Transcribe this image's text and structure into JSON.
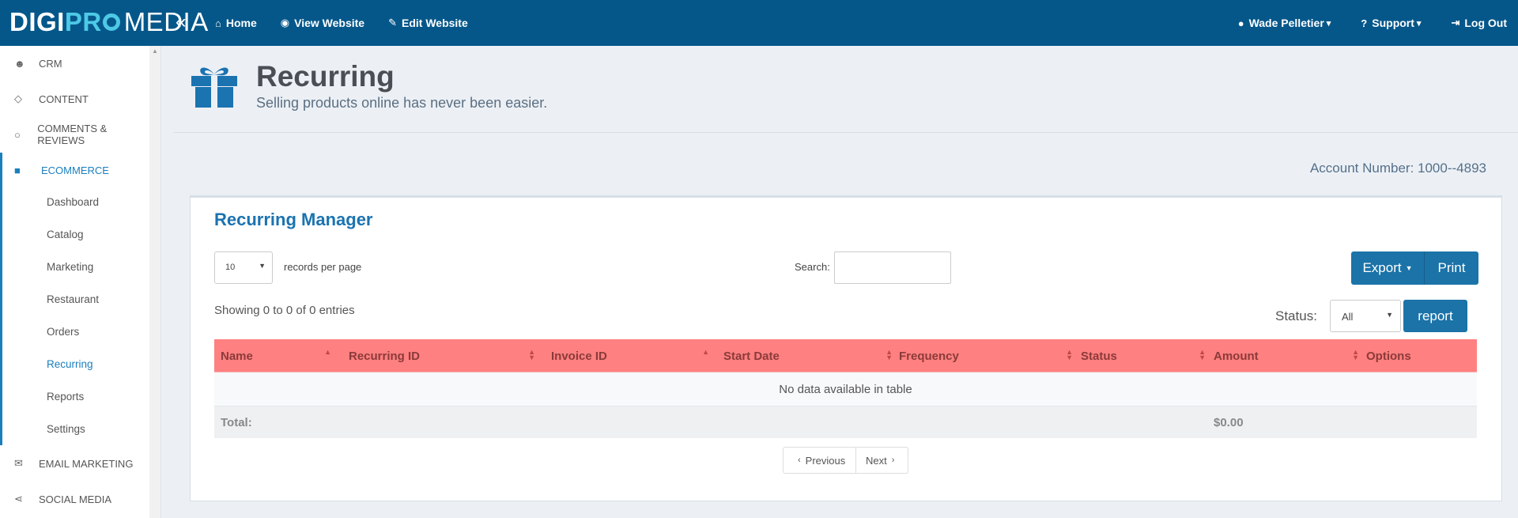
{
  "brand": {
    "part1": "DIGI",
    "part2a": "PR",
    "part2b": "",
    "part3": "MEDIA"
  },
  "topnav": {
    "collapse_glyph": "«",
    "links": [
      {
        "label": "Home",
        "icon": "home-icon"
      },
      {
        "label": "View Website",
        "icon": "eye-icon"
      },
      {
        "label": "Edit Website",
        "icon": "edit-icon"
      }
    ],
    "user": "Wade Pelletier",
    "support": "Support",
    "logout": "Log Out"
  },
  "sidebar": {
    "items": [
      {
        "label": "CRM",
        "icon": "users-icon"
      },
      {
        "label": "CONTENT",
        "icon": "diamond-icon"
      },
      {
        "label": "COMMENTS & REVIEWS",
        "icon": "comment-icon"
      },
      {
        "label": "ECOMMERCE",
        "icon": "gift-icon"
      },
      {
        "label": "EMAIL MARKETING",
        "icon": "envelope-icon"
      },
      {
        "label": "SOCIAL MEDIA",
        "icon": "share-icon"
      }
    ],
    "subitems": [
      "Dashboard",
      "Catalog",
      "Marketing",
      "Restaurant",
      "Orders",
      "Recurring",
      "Reports",
      "Settings"
    ]
  },
  "page": {
    "title": "Recurring",
    "subtitle": "Selling products online has never been easier.",
    "account_number": "Account Number: 1000--4893"
  },
  "panel": {
    "title": "Recurring Manager",
    "page_length": "10",
    "records_label": "records per page",
    "search_label": "Search:",
    "search_value": "",
    "export_label": "Export",
    "print_label": "Print",
    "showing": "Showing 0 to 0 of 0 entries",
    "status_label": "Status:",
    "status_value": "All",
    "report_label": "report",
    "columns": [
      "Name",
      "Recurring ID",
      "Invoice ID",
      "Start Date",
      "Frequency",
      "Status",
      "Amount",
      "Options"
    ],
    "empty_message": "No data available in table",
    "total_label": "Total:",
    "total_amount": "$0.00",
    "prev_label": "Previous",
    "next_label": "Next"
  },
  "colors": {
    "topbar": "#05578a",
    "accent": "#1b73b0",
    "table_header": "#ff8080"
  }
}
